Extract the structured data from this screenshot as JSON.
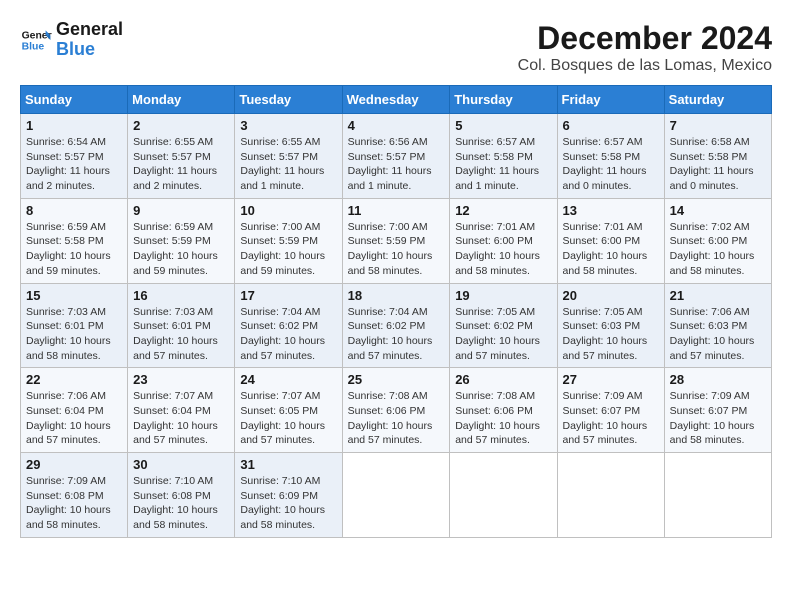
{
  "logo": {
    "line1": "General",
    "line2": "Blue"
  },
  "title": "December 2024",
  "location": "Col. Bosques de las Lomas, Mexico",
  "days_of_week": [
    "Sunday",
    "Monday",
    "Tuesday",
    "Wednesday",
    "Thursday",
    "Friday",
    "Saturday"
  ],
  "weeks": [
    [
      {
        "day": "1",
        "info": "Sunrise: 6:54 AM\nSunset: 5:57 PM\nDaylight: 11 hours and 2 minutes."
      },
      {
        "day": "2",
        "info": "Sunrise: 6:55 AM\nSunset: 5:57 PM\nDaylight: 11 hours and 2 minutes."
      },
      {
        "day": "3",
        "info": "Sunrise: 6:55 AM\nSunset: 5:57 PM\nDaylight: 11 hours and 1 minute."
      },
      {
        "day": "4",
        "info": "Sunrise: 6:56 AM\nSunset: 5:57 PM\nDaylight: 11 hours and 1 minute."
      },
      {
        "day": "5",
        "info": "Sunrise: 6:57 AM\nSunset: 5:58 PM\nDaylight: 11 hours and 1 minute."
      },
      {
        "day": "6",
        "info": "Sunrise: 6:57 AM\nSunset: 5:58 PM\nDaylight: 11 hours and 0 minutes."
      },
      {
        "day": "7",
        "info": "Sunrise: 6:58 AM\nSunset: 5:58 PM\nDaylight: 11 hours and 0 minutes."
      }
    ],
    [
      {
        "day": "8",
        "info": "Sunrise: 6:59 AM\nSunset: 5:58 PM\nDaylight: 10 hours and 59 minutes."
      },
      {
        "day": "9",
        "info": "Sunrise: 6:59 AM\nSunset: 5:59 PM\nDaylight: 10 hours and 59 minutes."
      },
      {
        "day": "10",
        "info": "Sunrise: 7:00 AM\nSunset: 5:59 PM\nDaylight: 10 hours and 59 minutes."
      },
      {
        "day": "11",
        "info": "Sunrise: 7:00 AM\nSunset: 5:59 PM\nDaylight: 10 hours and 58 minutes."
      },
      {
        "day": "12",
        "info": "Sunrise: 7:01 AM\nSunset: 6:00 PM\nDaylight: 10 hours and 58 minutes."
      },
      {
        "day": "13",
        "info": "Sunrise: 7:01 AM\nSunset: 6:00 PM\nDaylight: 10 hours and 58 minutes."
      },
      {
        "day": "14",
        "info": "Sunrise: 7:02 AM\nSunset: 6:00 PM\nDaylight: 10 hours and 58 minutes."
      }
    ],
    [
      {
        "day": "15",
        "info": "Sunrise: 7:03 AM\nSunset: 6:01 PM\nDaylight: 10 hours and 58 minutes."
      },
      {
        "day": "16",
        "info": "Sunrise: 7:03 AM\nSunset: 6:01 PM\nDaylight: 10 hours and 57 minutes."
      },
      {
        "day": "17",
        "info": "Sunrise: 7:04 AM\nSunset: 6:02 PM\nDaylight: 10 hours and 57 minutes."
      },
      {
        "day": "18",
        "info": "Sunrise: 7:04 AM\nSunset: 6:02 PM\nDaylight: 10 hours and 57 minutes."
      },
      {
        "day": "19",
        "info": "Sunrise: 7:05 AM\nSunset: 6:02 PM\nDaylight: 10 hours and 57 minutes."
      },
      {
        "day": "20",
        "info": "Sunrise: 7:05 AM\nSunset: 6:03 PM\nDaylight: 10 hours and 57 minutes."
      },
      {
        "day": "21",
        "info": "Sunrise: 7:06 AM\nSunset: 6:03 PM\nDaylight: 10 hours and 57 minutes."
      }
    ],
    [
      {
        "day": "22",
        "info": "Sunrise: 7:06 AM\nSunset: 6:04 PM\nDaylight: 10 hours and 57 minutes."
      },
      {
        "day": "23",
        "info": "Sunrise: 7:07 AM\nSunset: 6:04 PM\nDaylight: 10 hours and 57 minutes."
      },
      {
        "day": "24",
        "info": "Sunrise: 7:07 AM\nSunset: 6:05 PM\nDaylight: 10 hours and 57 minutes."
      },
      {
        "day": "25",
        "info": "Sunrise: 7:08 AM\nSunset: 6:06 PM\nDaylight: 10 hours and 57 minutes."
      },
      {
        "day": "26",
        "info": "Sunrise: 7:08 AM\nSunset: 6:06 PM\nDaylight: 10 hours and 57 minutes."
      },
      {
        "day": "27",
        "info": "Sunrise: 7:09 AM\nSunset: 6:07 PM\nDaylight: 10 hours and 57 minutes."
      },
      {
        "day": "28",
        "info": "Sunrise: 7:09 AM\nSunset: 6:07 PM\nDaylight: 10 hours and 58 minutes."
      }
    ],
    [
      {
        "day": "29",
        "info": "Sunrise: 7:09 AM\nSunset: 6:08 PM\nDaylight: 10 hours and 58 minutes."
      },
      {
        "day": "30",
        "info": "Sunrise: 7:10 AM\nSunset: 6:08 PM\nDaylight: 10 hours and 58 minutes."
      },
      {
        "day": "31",
        "info": "Sunrise: 7:10 AM\nSunset: 6:09 PM\nDaylight: 10 hours and 58 minutes."
      },
      null,
      null,
      null,
      null
    ]
  ]
}
